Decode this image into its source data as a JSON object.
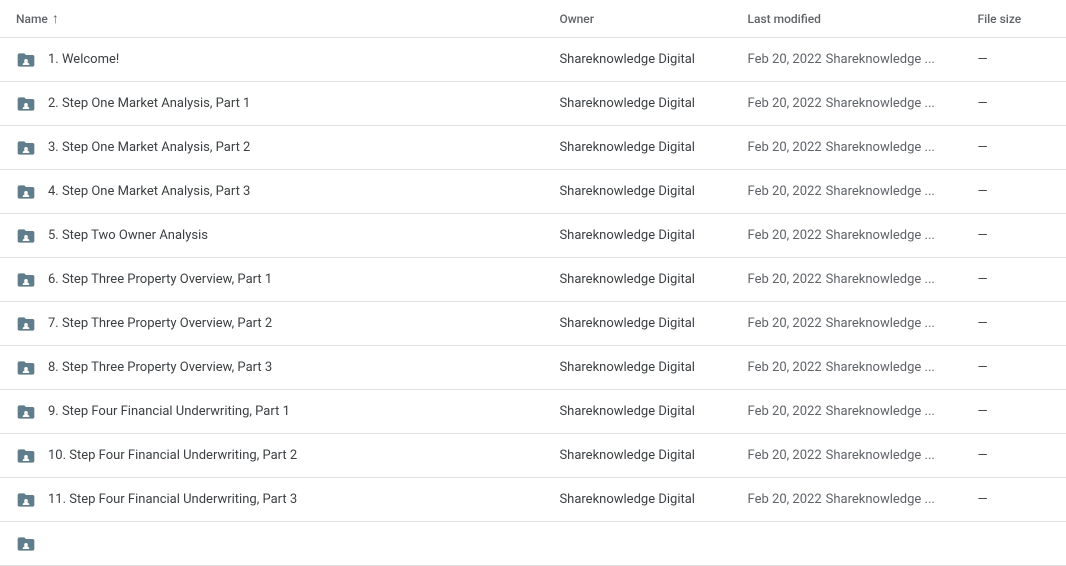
{
  "table": {
    "headers": {
      "name": "Name",
      "owner": "Owner",
      "last_modified": "Last modified",
      "file_size": "File size"
    },
    "sort_arrow": "↑",
    "rows": [
      {
        "id": 1,
        "name": "1. Welcome!",
        "owner": "Shareknowledge Digital",
        "modified_date": "Feb 20, 2022",
        "modified_by": "Shareknowledge ...",
        "size": "—"
      },
      {
        "id": 2,
        "name": "2. Step One Market Analysis, Part 1",
        "owner": "Shareknowledge Digital",
        "modified_date": "Feb 20, 2022",
        "modified_by": "Shareknowledge ...",
        "size": "—"
      },
      {
        "id": 3,
        "name": "3. Step One Market Analysis, Part 2",
        "owner": "Shareknowledge Digital",
        "modified_date": "Feb 20, 2022",
        "modified_by": "Shareknowledge ...",
        "size": "—"
      },
      {
        "id": 4,
        "name": "4. Step One Market Analysis, Part 3",
        "owner": "Shareknowledge Digital",
        "modified_date": "Feb 20, 2022",
        "modified_by": "Shareknowledge ...",
        "size": "—"
      },
      {
        "id": 5,
        "name": "5. Step Two Owner Analysis",
        "owner": "Shareknowledge Digital",
        "modified_date": "Feb 20, 2022",
        "modified_by": "Shareknowledge ...",
        "size": "—"
      },
      {
        "id": 6,
        "name": "6. Step Three Property Overview, Part 1",
        "owner": "Shareknowledge Digital",
        "modified_date": "Feb 20, 2022",
        "modified_by": "Shareknowledge ...",
        "size": "—"
      },
      {
        "id": 7,
        "name": "7. Step Three Property Overview, Part 2",
        "owner": "Shareknowledge Digital",
        "modified_date": "Feb 20, 2022",
        "modified_by": "Shareknowledge ...",
        "size": "—"
      },
      {
        "id": 8,
        "name": "8. Step Three Property Overview, Part 3",
        "owner": "Shareknowledge Digital",
        "modified_date": "Feb 20, 2022",
        "modified_by": "Shareknowledge ...",
        "size": "—"
      },
      {
        "id": 9,
        "name": "9. Step Four Financial Underwriting, Part 1",
        "owner": "Shareknowledge Digital",
        "modified_date": "Feb 20, 2022",
        "modified_by": "Shareknowledge ...",
        "size": "—"
      },
      {
        "id": 10,
        "name": "10. Step Four Financial Underwriting, Part 2",
        "owner": "Shareknowledge Digital",
        "modified_date": "Feb 20, 2022",
        "modified_by": "Shareknowledge ...",
        "size": "—"
      },
      {
        "id": 11,
        "name": "11. Step Four Financial Underwriting, Part 3",
        "owner": "Shareknowledge Digital",
        "modified_date": "Feb 20, 2022",
        "modified_by": "Shareknowledge ...",
        "size": "—"
      },
      {
        "id": 12,
        "name": "",
        "owner": "",
        "modified_date": "",
        "modified_by": "",
        "size": ""
      }
    ]
  }
}
